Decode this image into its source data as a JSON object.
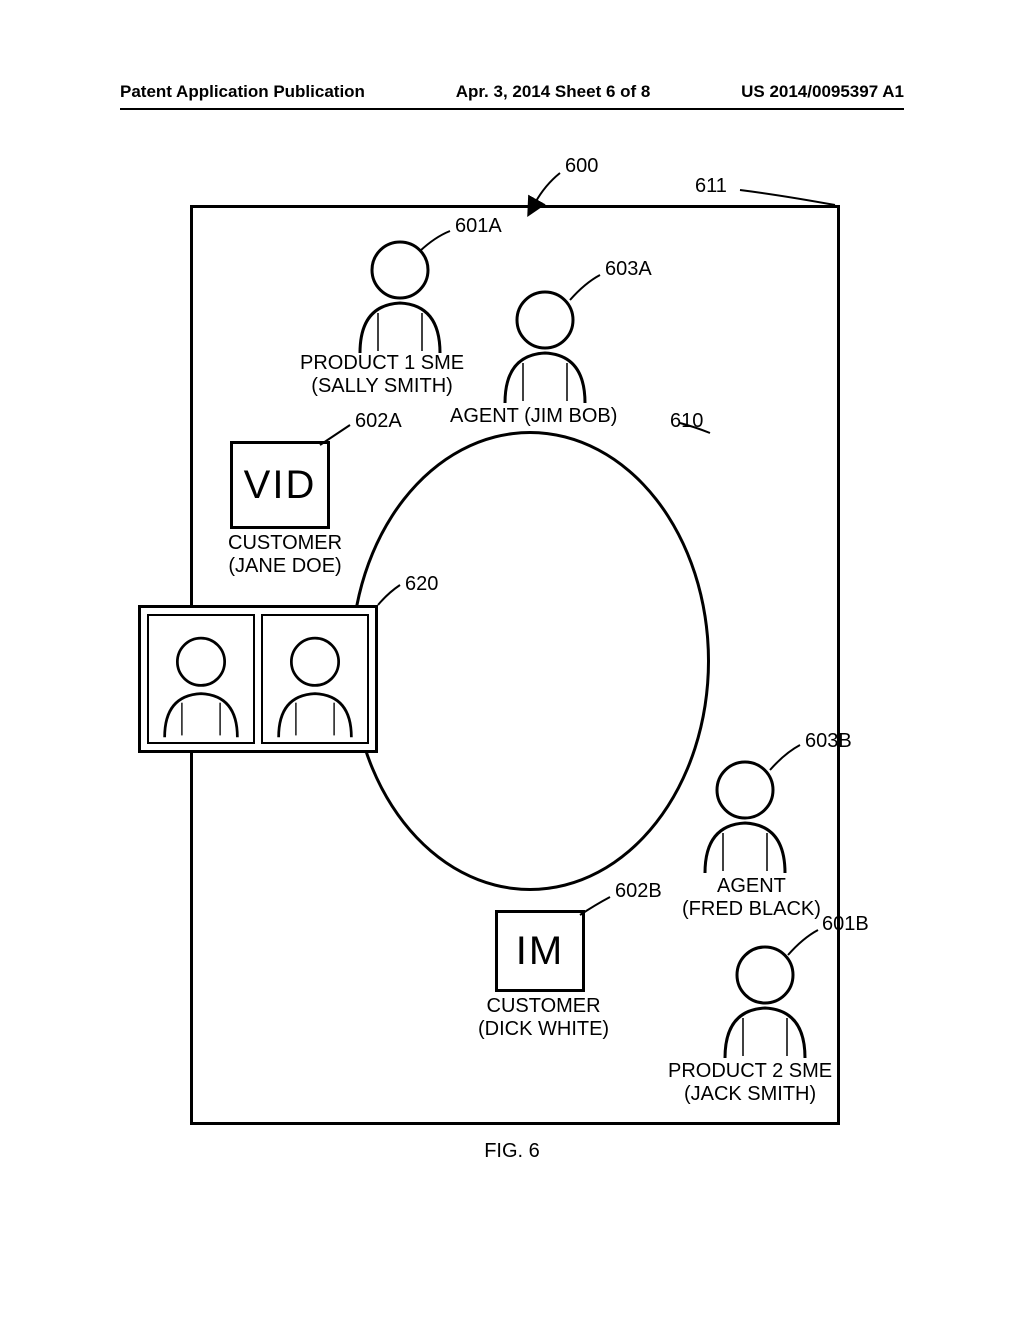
{
  "header": {
    "left": "Patent Application Publication",
    "center": "Apr. 3, 2014  Sheet 6 of 8",
    "right": "US 2014/0095397 A1"
  },
  "refs": {
    "r600": "600",
    "r611": "611",
    "r601A": "601A",
    "r603A": "603A",
    "r602A": "602A",
    "r610": "610",
    "r620": "620",
    "r603B": "603B",
    "r602B": "602B",
    "r601B": "601B"
  },
  "labels": {
    "sme1": "PRODUCT 1 SME\n(SALLY SMITH)",
    "agent1": "AGENT (JIM BOB)",
    "vid": "VID",
    "customer1": "CUSTOMER\n(JANE DOE)",
    "im": "IM",
    "customer2": "CUSTOMER\n(DICK WHITE)",
    "agent2": "AGENT\n(FRED BLACK)",
    "sme2": "PRODUCT 2 SME\n(JACK SMITH)"
  },
  "caption": "FIG. 6"
}
